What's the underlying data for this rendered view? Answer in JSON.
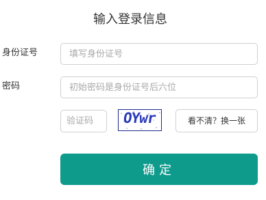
{
  "form": {
    "title": "输入登录信息",
    "id_label": "身份证号",
    "id_placeholder": "填写身份证号",
    "password_label": "密码",
    "password_placeholder": "初始密码是身份证号后六位",
    "captcha_placeholder": "验证码",
    "captcha_image_text": "OYwr",
    "refresh_label": "看不清？换一张",
    "submit_label": "确定"
  },
  "colors": {
    "accent": "#0e9b8c",
    "captcha_text": "#2a3ab8"
  }
}
